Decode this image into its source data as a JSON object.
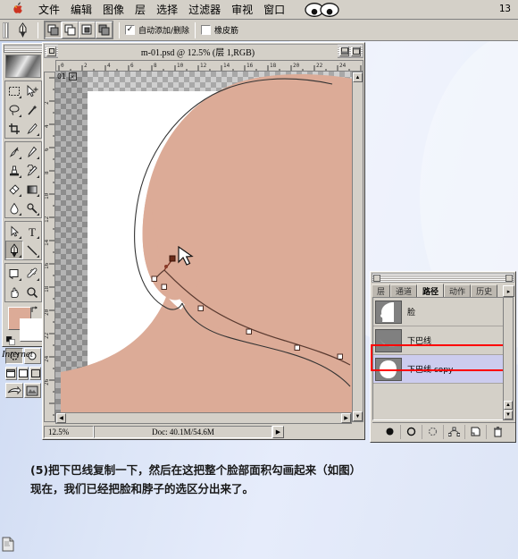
{
  "menubar": {
    "apple_icon": "apple-logo-icon",
    "items": [
      "文件",
      "编辑",
      "图像",
      "层",
      "选择",
      "过滤器",
      "审视",
      "窗口"
    ],
    "eyes_icon": "eyes-icon",
    "right_count": "13"
  },
  "optionsbar": {
    "tool_icon": "pen-tool-icon",
    "path_mode_buttons": [
      "add-to-path-area-icon",
      "subtract-from-path-area-icon",
      "intersect-path-areas-icon",
      "exclude-overlapping-path-areas-icon"
    ],
    "checkbox_auto": {
      "label": "自动添加/删除",
      "checked": true,
      "mark": "✓"
    },
    "checkbox_rubber": {
      "label": "橡皮筋",
      "checked": false,
      "mark": ""
    }
  },
  "toolbox": {
    "title": "toolbox-title-bar",
    "logo": "photoshop-logo",
    "tools": [
      {
        "name": "marquee-tool",
        "glyph": "marquee",
        "selected": false
      },
      {
        "name": "move-tool",
        "glyph": "move",
        "selected": false
      },
      {
        "name": "lasso-tool",
        "glyph": "lasso",
        "selected": false
      },
      {
        "name": "magic-wand-tool",
        "glyph": "wand",
        "selected": false
      },
      {
        "name": "crop-tool",
        "glyph": "crop",
        "selected": false
      },
      {
        "name": "slice-tool",
        "glyph": "slice",
        "selected": false
      },
      {
        "name": "healing-brush-tool",
        "glyph": "heal",
        "selected": false
      },
      {
        "name": "brush-tool",
        "glyph": "brush",
        "selected": false
      },
      {
        "name": "clone-stamp-tool",
        "glyph": "stamp",
        "selected": false
      },
      {
        "name": "history-brush-tool",
        "glyph": "historybrush",
        "selected": false
      },
      {
        "name": "eraser-tool",
        "glyph": "eraser",
        "selected": false
      },
      {
        "name": "gradient-tool",
        "glyph": "gradient",
        "selected": false
      },
      {
        "name": "blur-tool",
        "glyph": "blur",
        "selected": false
      },
      {
        "name": "dodge-tool",
        "glyph": "dodge",
        "selected": false
      },
      {
        "name": "path-selection-tool",
        "glyph": "pathselect",
        "selected": false
      },
      {
        "name": "type-tool",
        "glyph": "T",
        "selected": false
      },
      {
        "name": "pen-tool",
        "glyph": "pen",
        "selected": true
      },
      {
        "name": "line-tool",
        "glyph": "line",
        "selected": false
      },
      {
        "name": "notes-tool",
        "glyph": "notes",
        "selected": false
      },
      {
        "name": "eyedropper-tool",
        "glyph": "eyedropper",
        "selected": false
      },
      {
        "name": "hand-tool",
        "glyph": "hand",
        "selected": false
      },
      {
        "name": "zoom-tool",
        "glyph": "zoom",
        "selected": false
      }
    ],
    "colors": {
      "foreground": "#dcab97",
      "background": "#ffffff",
      "swap_icon": "swap-colors-icon",
      "reset_icon": "default-colors-icon"
    },
    "mask_modes": [
      "standard-mask-mode",
      "quick-mask-mode"
    ],
    "screen_modes": [
      "standard-screen-mode",
      "full-screen-menubar-mode",
      "full-screen-mode"
    ],
    "jump_buttons": [
      "jump-to-imageready-icon",
      "jump-preview-icon"
    ],
    "internet_label": "Internet"
  },
  "document": {
    "title": "m-01.psd @ 12.5% (层 1,RGB)",
    "badge_label": "01",
    "close_icon": "close-box-icon",
    "minimize_icon": "minimize-box-icon",
    "maximize_icon": "maximize-box-icon",
    "status": {
      "zoom": "12.5%",
      "doc_size": "Doc: 40.1M/54.6M",
      "popup_icon": "status-popup-arrow-icon"
    },
    "ruler_units": "cm",
    "ruler_h_labels": [
      "0",
      "2",
      "4",
      "6",
      "8",
      "10",
      "12",
      "14",
      "16",
      "18",
      "20",
      "22",
      "24"
    ],
    "ruler_v_labels": [
      "2",
      "4",
      "6",
      "8",
      "10",
      "12",
      "14",
      "16",
      "18",
      "20",
      "22",
      "24",
      "26"
    ],
    "artwork": {
      "skin_color": "#dcab97",
      "path_stroke": "#3a3030",
      "anchor_count": 7
    }
  },
  "palette": {
    "tabs": [
      {
        "label": "层",
        "active": false
      },
      {
        "label": "通道",
        "active": false
      },
      {
        "label": "路径",
        "active": true
      },
      {
        "label": "动作",
        "active": false
      },
      {
        "label": "历史",
        "active": false
      }
    ],
    "menu_arrow_icon": "palette-menu-arrow-icon",
    "paths": [
      {
        "name": "脸",
        "selected": false,
        "thumb": "face-silhouette-thumb"
      },
      {
        "name": "下巴线",
        "selected": false,
        "thumb": "chin-line-thumb"
      },
      {
        "name": "下巴线 copy",
        "selected": true,
        "thumb": "chin-line-copy-thumb"
      }
    ],
    "selection_highlight_color": "#ff0000",
    "bottom_buttons": [
      "fill-path-icon",
      "stroke-path-icon",
      "load-path-as-selection-icon",
      "make-work-path-icon",
      "new-path-icon",
      "delete-path-icon"
    ],
    "scroll_up_icon": "scroll-up-arrow-icon",
    "scroll_down_icon": "scroll-down-arrow-icon"
  },
  "caption": {
    "line1": "(5)把下巴线复制一下，然后在这把整个脸部面积勾画起来（如图）",
    "line2": "现在，我们已经把脸和脖子的选区分出来了。"
  },
  "taskbar": {
    "tray_icon": "document-tray-icon"
  }
}
